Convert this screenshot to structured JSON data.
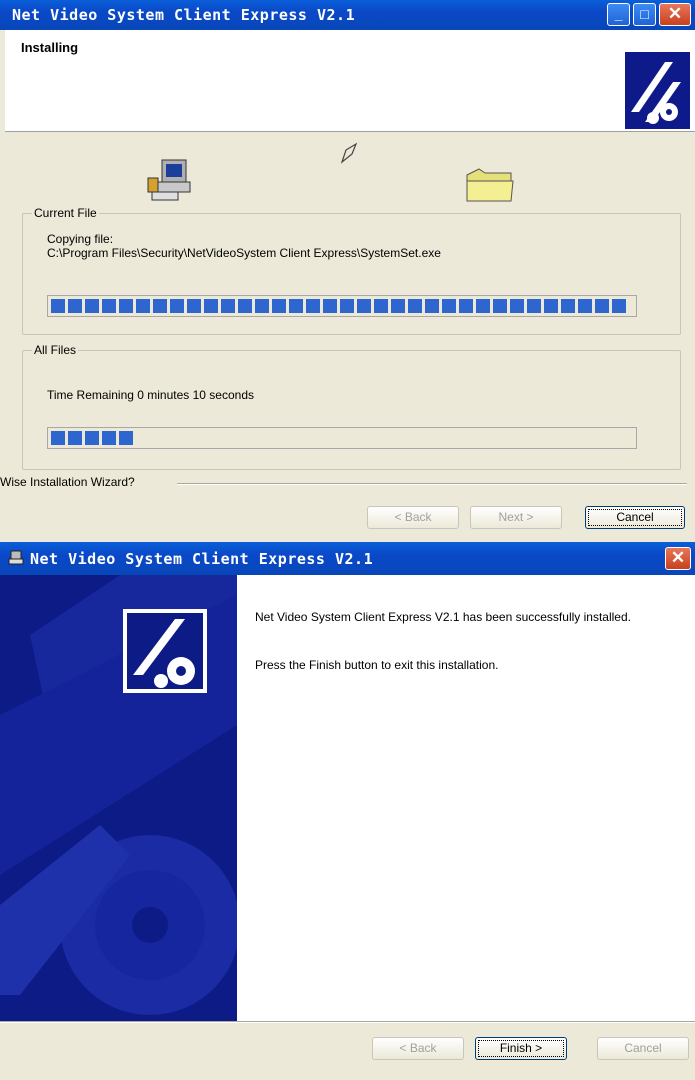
{
  "installing_window": {
    "title": "Net Video System Client Express V2.1",
    "header_title": "Installing",
    "current_file": {
      "label": "Current File",
      "copying_label": "Copying file:",
      "path": "C:\\Program Files\\Security\\NetVideoSystem Client Express\\SystemSet.exe",
      "progress": 1.0
    },
    "all_files": {
      "label": "All Files",
      "time_remaining": "Time Remaining 0 minutes 10 seconds",
      "progress": 0.16
    },
    "wizard_label": "Wise Installation Wizard?",
    "buttons": {
      "back": "< Back",
      "next": "Next >",
      "cancel": "Cancel"
    },
    "colors": {
      "titlebar": "#0a48c8",
      "progress": "#2e66cf"
    }
  },
  "finish_window": {
    "title": "Net Video System Client Express V2.1",
    "message_1": "Net Video System Client Express V2.1 has been successfully installed.",
    "message_2": "Press the Finish button to exit this installation.",
    "buttons": {
      "back": "< Back",
      "finish": "Finish >",
      "cancel": "Cancel"
    },
    "colors": {
      "sidebar": "#0d1b86"
    }
  }
}
